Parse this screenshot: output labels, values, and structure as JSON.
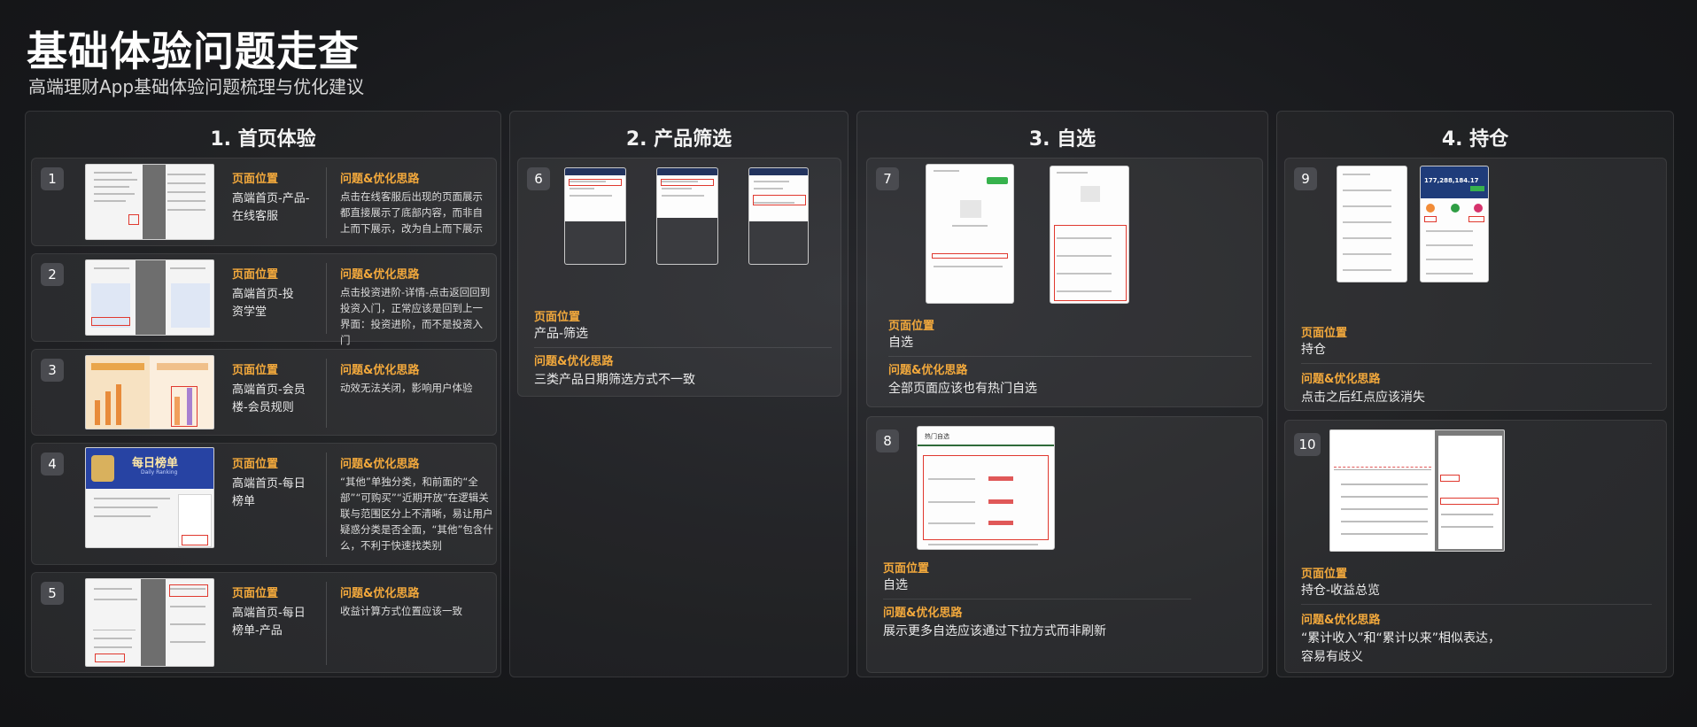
{
  "header": {
    "title": "基础体验问题走查",
    "subtitle": "高端理财App基础体验问题梳理与优化建议"
  },
  "labels": {
    "location": "页面位置",
    "issue": "问题&优化思路"
  },
  "sections": [
    {
      "title": "1. 首页体验",
      "items": [
        {
          "num": "1",
          "location": "高端首页-产品-在线客服",
          "issue": "点击在线客服后出现的页面展示都直接展示了底部内容，而非自上而下展示，改为自上而下展示"
        },
        {
          "num": "2",
          "location": "高端首页-投资学堂",
          "issue": "点击投资进阶-详情-点击返回回到投资入门，正常应该是回到上一界面：投资进阶，而不是投资入门"
        },
        {
          "num": "3",
          "location": "高端首页-会员楼-会员规则",
          "issue": "动效无法关闭，影响用户体验"
        },
        {
          "num": "4",
          "location": "高端首页-每日榜单",
          "issue": "“其他”单独分类，和前面的“全部”“可购买”“近期开放”在逻辑关联与范围区分上不清晰，易让用户疑惑分类是否全面，“其他”包含什么，不利于快速找类别"
        },
        {
          "num": "5",
          "location": "高端首页-每日榜单-产品",
          "issue": "收益计算方式位置应该一致"
        }
      ]
    },
    {
      "title": "2. 产品筛选",
      "items": [
        {
          "num": "6",
          "location": "产品-筛选",
          "issue": "三类产品日期筛选方式不一致"
        }
      ]
    },
    {
      "title": "3. 自选",
      "items": [
        {
          "num": "7",
          "location": "自选",
          "issue": "全部页面应该也有热门自选"
        },
        {
          "num": "8",
          "location": "自选",
          "issue": "展示更多自选应该通过下拉方式而非刷新"
        }
      ]
    },
    {
      "title": "4. 持仓",
      "items": [
        {
          "num": "9",
          "location": "持仓",
          "issue": "点击之后红点应该消失"
        },
        {
          "num": "10",
          "location": "持仓-收益总览",
          "issue": "“累计收入”和“累计以来”相似表达，容易有歧义"
        }
      ]
    }
  ],
  "thumbnails": {
    "ranking_banner": "每日榜单",
    "ranking_banner_sub": "Daily Ranking",
    "fav_tab_hot": "热门自选",
    "holding_amount": "177,288,184.17"
  },
  "colors": {
    "accent_orange": "#f3a93c",
    "highlight_red": "#e0392f",
    "background": "#18191c"
  }
}
